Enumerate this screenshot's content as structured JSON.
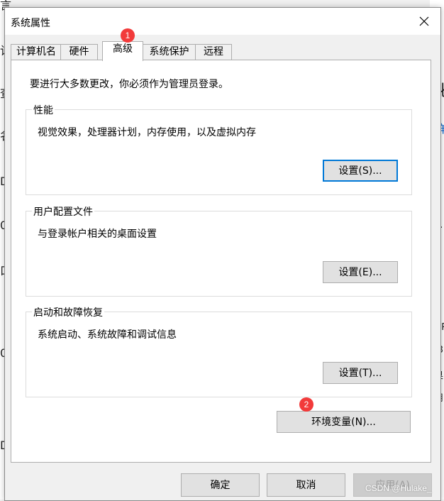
{
  "dialog": {
    "title": "系统属性",
    "tabs": [
      "计算机名",
      "硬件",
      "高级",
      "系统保护",
      "远程"
    ],
    "active_tab": "高级",
    "admin_note": "要进行大多数更改，你必须作为管理员登录。",
    "performance": {
      "label": "性能",
      "description": "视觉效果，处理器计划，内存使用，以及虚拟内存",
      "button": "设置(S)..."
    },
    "user_profiles": {
      "label": "用户配置文件",
      "description": "与登录帐户相关的桌面设置",
      "button": "设置(E)..."
    },
    "startup_recovery": {
      "label": "启动和故障恢复",
      "description": "系统启动、系统故障和调试信息",
      "button": "设置(T)..."
    },
    "env_button": "环境变量(N)...",
    "ok_button": "确定",
    "cancel_button": "取消",
    "apply_button": "应用(A)"
  },
  "annotations": [
    "1",
    "2"
  ],
  "watermark": "CSDN @Hulake_",
  "background_fragments": {
    "left": [
      "言",
      "计",
      "查",
      "名",
      "D",
      "0",
      "口",
      "0",
      "D"
    ],
    "right": [
      "化",
      "详",
      "1",
      "0",
      "3",
      "OR",
      "-3",
      "奥",
      "用"
    ]
  }
}
